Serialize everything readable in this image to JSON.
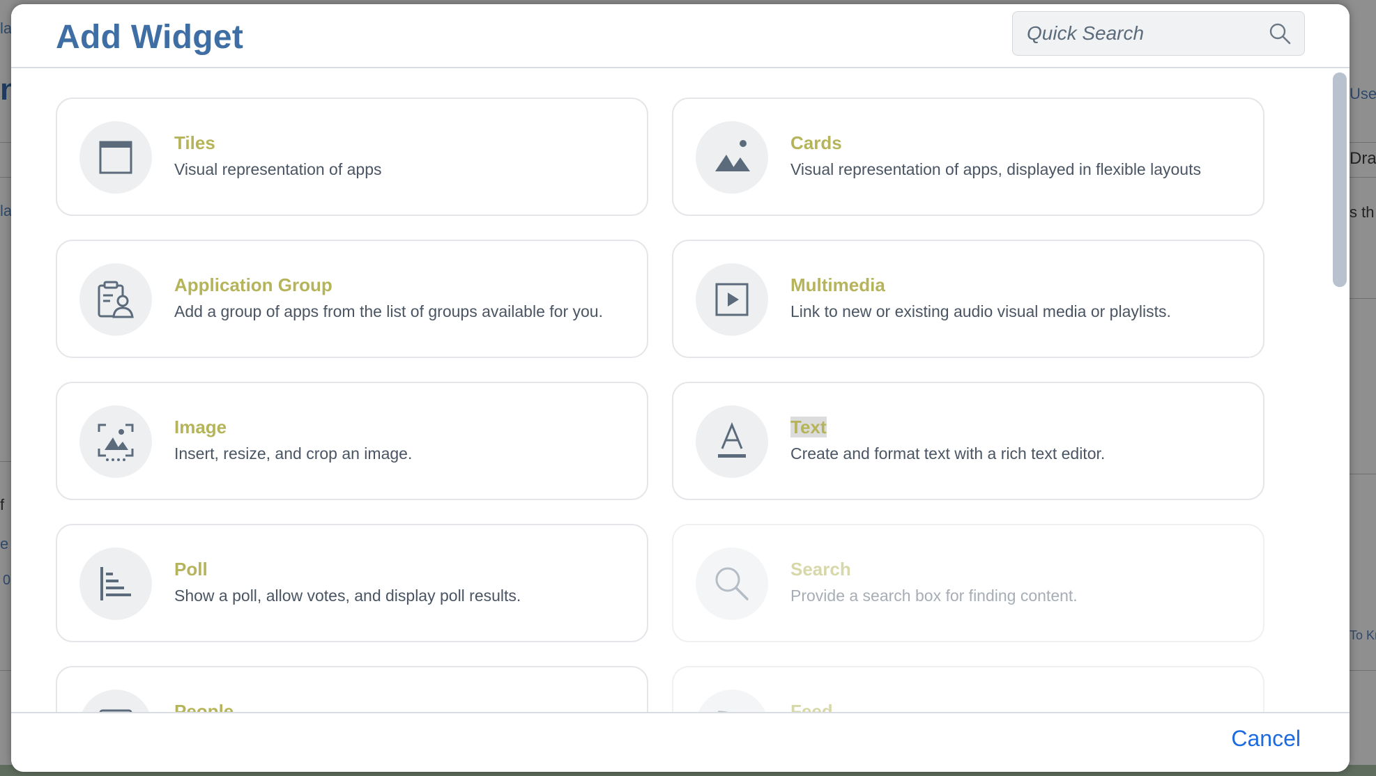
{
  "background": {
    "fragments": [
      "la",
      "n",
      "la",
      "f",
      "e",
      "0",
      "User",
      "Draft",
      "s th",
      "To Kn"
    ]
  },
  "dialog": {
    "title": "Add Widget",
    "search": {
      "placeholder": "Quick Search",
      "icon": "search-icon"
    },
    "widgets": [
      {
        "id": "tiles",
        "title": "Tiles",
        "description": "Visual representation of apps",
        "icon": "window-icon",
        "enabled": true
      },
      {
        "id": "cards",
        "title": "Cards",
        "description": "Visual representation of apps, displayed in flexible layouts",
        "icon": "landscape-icon",
        "enabled": true
      },
      {
        "id": "application-group",
        "title": "Application Group",
        "description": "Add a group of apps from the list of groups available for you.",
        "icon": "clipboard-user-icon",
        "enabled": true
      },
      {
        "id": "multimedia",
        "title": "Multimedia",
        "description": "Link to new or existing audio visual media or playlists.",
        "icon": "play-icon",
        "enabled": true
      },
      {
        "id": "image",
        "title": "Image",
        "description": "Insert, resize, and crop an image.",
        "icon": "image-crop-icon",
        "enabled": true
      },
      {
        "id": "text",
        "title": "Text",
        "description": "Create and format text with a rich text editor.",
        "icon": "text-format-icon",
        "enabled": true
      },
      {
        "id": "poll",
        "title": "Poll",
        "description": "Show a poll, allow votes, and display poll results.",
        "icon": "bar-chart-icon",
        "enabled": true
      },
      {
        "id": "search",
        "title": "Search",
        "description": "Provide a search box for finding content.",
        "icon": "magnifier-icon",
        "enabled": false
      },
      {
        "id": "people",
        "title": "People",
        "description": "",
        "icon": "people-icon",
        "enabled": true
      },
      {
        "id": "feed",
        "title": "Feed",
        "description": "",
        "icon": "feed-icon",
        "enabled": false
      }
    ],
    "cancel_label": "Cancel"
  },
  "colors": {
    "title": "#3e6ea3",
    "widget_title": "#b5b45a",
    "link": "#1c6be0"
  }
}
